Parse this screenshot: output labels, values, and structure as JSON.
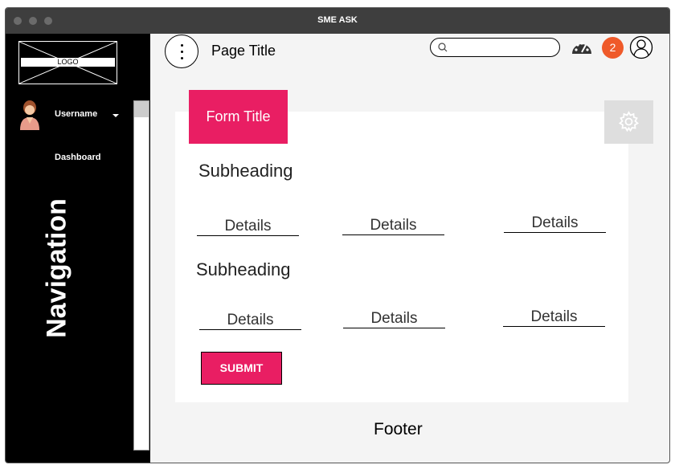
{
  "window": {
    "title": "SME ASK"
  },
  "sidebar": {
    "logo": "LOGO",
    "username": "Username",
    "dashboard": "Dashboard",
    "navigation": "Navigation"
  },
  "topbar": {
    "page_title": "Page Title",
    "search_placeholder": "",
    "notification_count": "2"
  },
  "form": {
    "title": "Form Title",
    "sections": [
      {
        "subheading": "Subheading",
        "fields": [
          "Details",
          "Details",
          "Details"
        ]
      },
      {
        "subheading": "Subheading",
        "fields": [
          "Details",
          "Details",
          "Details"
        ]
      }
    ],
    "submit_label": "SUBMIT"
  },
  "footer": {
    "text": "Footer"
  },
  "colors": {
    "accent": "#e91e63",
    "badge": "#ef5a2a",
    "sidebar": "#000000",
    "titlebar": "#3e3e3e"
  },
  "icons": [
    "kebab-menu-icon",
    "search-icon",
    "gauge-icon",
    "user-icon",
    "gear-icon",
    "caret-down-icon"
  ]
}
